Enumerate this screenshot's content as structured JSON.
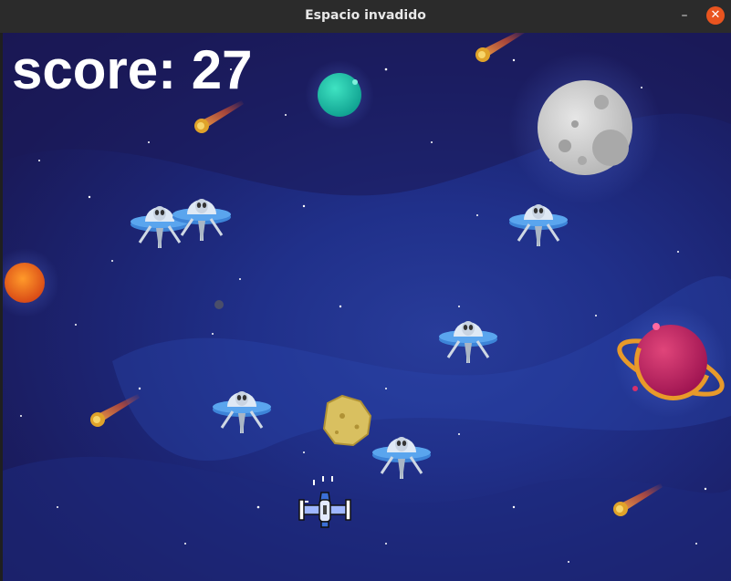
{
  "window": {
    "title": "Espacio invadido",
    "minimize_symbol": "–",
    "close_symbol": "✕"
  },
  "hud": {
    "score_text": "score: 27"
  },
  "colors": {
    "titlebar": "#2b2b2b",
    "close": "#e9541f",
    "space": "#1c2472",
    "ufo": "#4a90e2"
  },
  "icons": {
    "player": "spaceship-icon",
    "enemy": "ufo-alien-icon",
    "meteor": "meteor-icon",
    "planet": "planet-icon",
    "moon": "moon-icon",
    "asteroid": "asteroid-icon"
  }
}
